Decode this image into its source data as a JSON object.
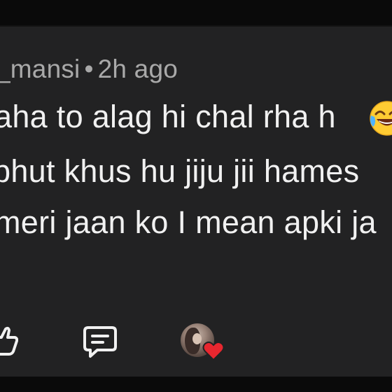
{
  "comment": {
    "meta": {
      "username": "_mansi",
      "separator": "•",
      "time": "2h ago"
    },
    "lines": [
      "aha to alag hi chal rha h",
      "bhut khus hu jiju jii hames",
      "meri jaan ko I mean apki ja"
    ],
    "emoji": "face-with-tears-of-joy"
  },
  "actions": {
    "like_icon": "thumbs-up-icon",
    "reply_icon": "reply-icon",
    "creator_heart_icon": "heart-icon"
  },
  "colors": {
    "background": "#222223",
    "top_bar": "#0a0a0a",
    "meta_text": "#a9a9a9",
    "comment_text": "#f1f1f1",
    "heart": "#e8272f"
  }
}
